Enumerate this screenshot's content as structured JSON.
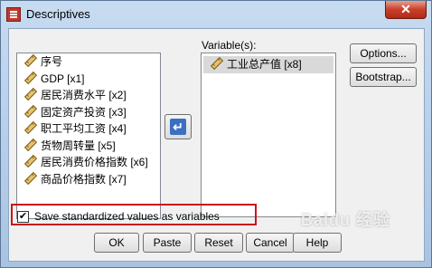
{
  "window": {
    "title": "Descriptives",
    "close_glyph": "✕"
  },
  "source_list": {
    "items": [
      {
        "label": "序号",
        "icon": "scale-ruler-icon"
      },
      {
        "label": "GDP [x1]",
        "icon": "scale-ruler-icon"
      },
      {
        "label": "居民消费水平 [x2]",
        "icon": "scale-ruler-icon"
      },
      {
        "label": "固定资产投资 [x3]",
        "icon": "scale-ruler-icon"
      },
      {
        "label": "职工平均工资 [x4]",
        "icon": "scale-ruler-icon"
      },
      {
        "label": "货物周转量 [x5]",
        "icon": "scale-ruler-icon"
      },
      {
        "label": "居民消费价格指数 [x6]",
        "icon": "scale-ruler-icon"
      },
      {
        "label": "商品价格指数 [x7]",
        "icon": "scale-ruler-icon"
      }
    ]
  },
  "move_button": {
    "glyph": "↵"
  },
  "variables": {
    "label": "Variable(s):",
    "items": [
      {
        "label": "工业总产值 [x8]",
        "icon": "scale-ruler-icon"
      }
    ]
  },
  "side_buttons": {
    "options": "Options...",
    "bootstrap": "Bootstrap..."
  },
  "save_checkbox": {
    "checked": true,
    "check_glyph": "✔",
    "label": "Save standardized values as variables"
  },
  "footer": {
    "ok": "OK",
    "paste": "Paste",
    "reset": "Reset",
    "cancel": "Cancel",
    "help": "Help"
  },
  "watermark": "Baidu 经验"
}
